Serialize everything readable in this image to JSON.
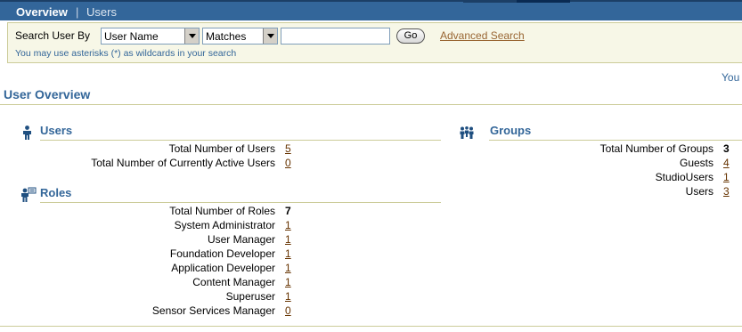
{
  "nav": {
    "tab_overview": "Overview",
    "separator": "|",
    "tab_users": "Users"
  },
  "search": {
    "label": "Search User By",
    "field_select": "User Name",
    "operator_select": "Matches",
    "input_value": "",
    "go_label": "Go",
    "advanced_link": "Advanced Search",
    "hint": "You may use asterisks (*) as wildcards in your search"
  },
  "truncated_text": "You",
  "page_title": "User Overview",
  "users": {
    "title": "Users",
    "rows": [
      {
        "label": "Total Number of Users",
        "value": "5"
      },
      {
        "label": "Total Number of Currently Active Users",
        "value": "0"
      }
    ]
  },
  "roles": {
    "title": "Roles",
    "rows": [
      {
        "label": "Total Number of Roles",
        "value": "7"
      },
      {
        "label": "System Administrator",
        "value": "1"
      },
      {
        "label": "User Manager",
        "value": "1"
      },
      {
        "label": "Foundation Developer",
        "value": "1"
      },
      {
        "label": "Application Developer",
        "value": "1"
      },
      {
        "label": "Content Manager",
        "value": "1"
      },
      {
        "label": "Superuser",
        "value": "1"
      },
      {
        "label": "Sensor Services Manager",
        "value": "0"
      }
    ]
  },
  "groups": {
    "title": "Groups",
    "rows": [
      {
        "label": "Total Number of Groups",
        "value": "3"
      },
      {
        "label": "Guests",
        "value": "4"
      },
      {
        "label": "StudioUsers",
        "value": "1"
      },
      {
        "label": "Users",
        "value": "3"
      }
    ]
  },
  "icons": {
    "users": "person-icon",
    "roles": "person-with-card-icon",
    "groups": "people-group-icon"
  },
  "colors": {
    "nav_bg": "#33669a",
    "heading": "#336699",
    "link": "#663300",
    "panel_bg": "#f7f7e7"
  }
}
